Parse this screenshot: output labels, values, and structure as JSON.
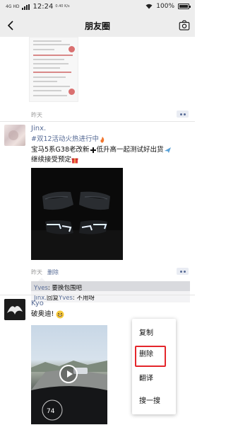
{
  "status_bar": {
    "network_label": "4G HD",
    "time": "12:24",
    "net_speed": "0.40 K/s",
    "battery_percent": "100%",
    "battery_level": 1.0
  },
  "nav": {
    "title": "朋友圈",
    "back_icon": "chevron-left-icon",
    "camera_icon": "camera-icon"
  },
  "previous_post": {
    "time": "昨天"
  },
  "post_jinx": {
    "username": "Jinx.",
    "hashtag": "#双12活动火热进行中",
    "line2": "宝马5系G38老改新",
    "line2_rest": "低升高一起测试好出货",
    "line3": "继续接受预定",
    "time": "昨天",
    "delete_label": "删除",
    "comments": [
      {
        "name": "Yves",
        "sep": ": ",
        "text": "要换包围吧"
      },
      {
        "name": "Jinx.",
        "reply": "回复",
        "target": "Yves",
        "sep": ": ",
        "text": "不用呀"
      }
    ]
  },
  "post_kyo": {
    "username": "Kyo",
    "text": "破奥迪!"
  },
  "context_menu": {
    "items": [
      "复制",
      "删除",
      "翻译",
      "搜一搜"
    ],
    "highlighted": "删除"
  }
}
